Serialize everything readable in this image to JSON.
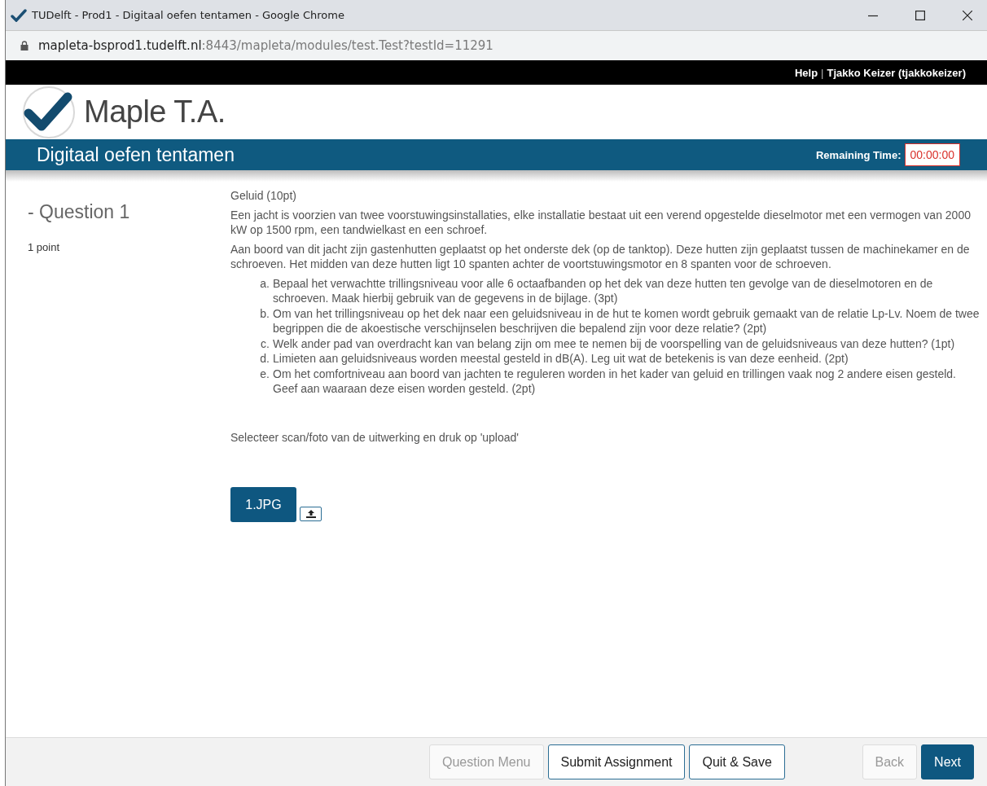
{
  "window": {
    "title": "TUDelft - Prod1 - Digitaal oefen tentamen - Google Chrome"
  },
  "address_bar": {
    "host": "mapleta-bsprod1.tudelft.nl",
    "path": ":8443/mapleta/modules/test.Test?testId=11291"
  },
  "top_bar": {
    "links": [
      "Help",
      "Tjakko Keizer (tjakkokeizer)"
    ],
    "separator": "|"
  },
  "logo": {
    "text": "Maple T.A."
  },
  "banner": {
    "title": "Digitaal oefen tentamen",
    "timer_label": "Remaining Time:",
    "timer": "00:00:00"
  },
  "question": {
    "heading": "- Question 1",
    "points": "1 point",
    "title": "Geluid (10pt)",
    "paragraphs": [
      "Een jacht is voorzien van twee voorstuwingsinstallaties, elke installatie bestaat uit een verend opgestelde dieselmotor met een vermogen van 2000 kW op 1500 rpm, een tandwielkast en een schroef.",
      "Aan boord van dit jacht zijn gastenhutten geplaatst op het onderste dek (op de tanktop). Deze hutten zijn geplaatst tussen de machinekamer en de schroeven. Het midden van deze hutten ligt 10 spanten achter de voortstuwingsmotor en 8 spanten voor de schroeven."
    ],
    "items": [
      {
        "marker": "a.",
        "text": "Bepaal het verwachtte trillingsniveau voor alle 6 octaafbanden op het dek van deze hutten ten gevolge van de dieselmotoren en de schroeven. Maak hierbij gebruik van de gegevens in de bijlage. (3pt)"
      },
      {
        "marker": "b.",
        "text": "Om van het trillingsniveau op het dek naar een geluidsniveau in de hut te komen wordt gebruik gemaakt van de relatie Lp-Lv. Noem de twee begrippen die de akoestische verschijnselen beschrijven die bepalend zijn voor deze relatie? (2pt)"
      },
      {
        "marker": "c.",
        "text": "Welk ander pad van overdracht kan van belang zijn om mee te nemen bij de voorspelling van de geluidsniveaus van deze hutten? (1pt)"
      },
      {
        "marker": "d.",
        "text": "Limieten aan geluidsniveaus worden meestal gesteld in dB(A). Leg uit wat de betekenis is van deze eenheid. (2pt)"
      },
      {
        "marker": "e.",
        "text": "Om het comfortniveau aan boord van jachten te reguleren worden in het kader van geluid en trillingen vaak nog 2 andere eisen gesteld. Geef aan waaraan deze eisen worden gesteld. (2pt)"
      }
    ],
    "instruction": "Selecteer scan/foto van de uitwerking en druk op 'upload'",
    "file_button": "1.JPG"
  },
  "footer": {
    "left_buttons": [
      {
        "label": "Question Menu",
        "disabled": true,
        "primary": false
      },
      {
        "label": "Submit Assignment",
        "disabled": false,
        "primary": false
      },
      {
        "label": "Quit & Save",
        "disabled": false,
        "primary": false
      }
    ],
    "right_buttons": [
      {
        "label": "Back",
        "disabled": true,
        "primary": false
      },
      {
        "label": "Next",
        "disabled": false,
        "primary": true
      }
    ]
  }
}
